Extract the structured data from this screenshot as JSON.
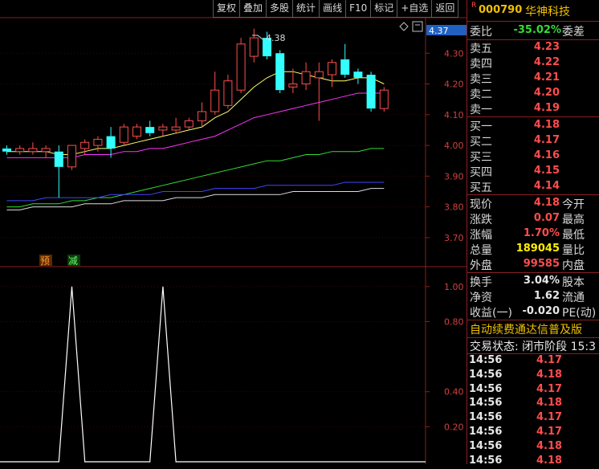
{
  "toolbar": [
    "复权",
    "叠加",
    "多股",
    "统计",
    "画线",
    "F10",
    "标记",
    "+自选",
    "返回"
  ],
  "chart": {
    "price_badge": "4.37",
    "high_label": "4.38",
    "price_axis": [
      "4.30",
      "4.20",
      "4.10",
      "4.00",
      "3.90",
      "3.80",
      "3.70"
    ],
    "markers": {
      "pre": "预",
      "reduce": "减"
    },
    "indicator_axis": [
      "1.00",
      "0.80",
      "0.40",
      "0.20"
    ],
    "collapse_icon": "diamond-icon"
  },
  "chart_data": {
    "type": "candlestick",
    "up_color": "#ff4d4d",
    "down_color": "#33ffff",
    "ylim": [
      3.65,
      4.4
    ],
    "candles": [
      {
        "o": 3.99,
        "h": 4.0,
        "l": 3.97,
        "c": 3.98
      },
      {
        "o": 3.98,
        "h": 4.0,
        "l": 3.97,
        "c": 3.99
      },
      {
        "o": 3.98,
        "h": 4.01,
        "l": 3.97,
        "c": 3.99
      },
      {
        "o": 3.98,
        "h": 4.0,
        "l": 3.96,
        "c": 3.99
      },
      {
        "o": 3.98,
        "h": 4.0,
        "l": 3.83,
        "c": 3.93
      },
      {
        "o": 3.93,
        "h": 4.0,
        "l": 3.92,
        "c": 4.0
      },
      {
        "o": 3.99,
        "h": 4.02,
        "l": 3.97,
        "c": 4.01
      },
      {
        "o": 4.0,
        "h": 4.03,
        "l": 3.98,
        "c": 4.02
      },
      {
        "o": 4.03,
        "h": 4.06,
        "l": 3.96,
        "c": 3.99
      },
      {
        "o": 4.01,
        "h": 4.07,
        "l": 4.0,
        "c": 4.06
      },
      {
        "o": 4.03,
        "h": 4.07,
        "l": 4.02,
        "c": 4.06
      },
      {
        "o": 4.06,
        "h": 4.08,
        "l": 4.03,
        "c": 4.04
      },
      {
        "o": 4.05,
        "h": 4.07,
        "l": 4.03,
        "c": 4.06
      },
      {
        "o": 4.05,
        "h": 4.09,
        "l": 4.04,
        "c": 4.06
      },
      {
        "o": 4.06,
        "h": 4.09,
        "l": 4.05,
        "c": 4.08
      },
      {
        "o": 4.08,
        "h": 4.14,
        "l": 4.06,
        "c": 4.11
      },
      {
        "o": 4.11,
        "h": 4.24,
        "l": 4.1,
        "c": 4.18
      },
      {
        "o": 4.13,
        "h": 4.23,
        "l": 4.12,
        "c": 4.21
      },
      {
        "o": 4.18,
        "h": 4.35,
        "l": 4.17,
        "c": 4.33
      },
      {
        "o": 4.29,
        "h": 4.38,
        "l": 4.27,
        "c": 4.35
      },
      {
        "o": 4.35,
        "h": 4.37,
        "l": 4.28,
        "c": 4.29
      },
      {
        "o": 4.3,
        "h": 4.31,
        "l": 4.17,
        "c": 4.18
      },
      {
        "o": 4.19,
        "h": 4.25,
        "l": 4.17,
        "c": 4.2
      },
      {
        "o": 4.2,
        "h": 4.27,
        "l": 4.18,
        "c": 4.24
      },
      {
        "o": 4.22,
        "h": 4.27,
        "l": 4.08,
        "c": 4.24
      },
      {
        "o": 4.23,
        "h": 4.28,
        "l": 4.19,
        "c": 4.27
      },
      {
        "o": 4.28,
        "h": 4.33,
        "l": 4.22,
        "c": 4.23
      },
      {
        "o": 4.24,
        "h": 4.25,
        "l": 4.2,
        "c": 4.22
      },
      {
        "o": 4.23,
        "h": 4.24,
        "l": 4.11,
        "c": 4.12
      },
      {
        "o": 4.12,
        "h": 4.19,
        "l": 4.11,
        "c": 4.18
      }
    ],
    "ma": [
      {
        "color": "#ffff66",
        "values": [
          3.98,
          3.98,
          3.98,
          3.98,
          3.97,
          3.97,
          3.98,
          3.99,
          3.99,
          4.0,
          4.01,
          4.02,
          4.03,
          4.04,
          4.05,
          4.06,
          4.09,
          4.11,
          4.15,
          4.19,
          4.22,
          4.24,
          4.24,
          4.23,
          4.22,
          4.21,
          4.21,
          4.22,
          4.22,
          4.2
        ]
      },
      {
        "color": "#ff33ff",
        "values": [
          3.96,
          3.96,
          3.96,
          3.96,
          3.96,
          3.96,
          3.97,
          3.97,
          3.97,
          3.98,
          3.98,
          3.99,
          3.99,
          4.0,
          4.01,
          4.02,
          4.03,
          4.05,
          4.07,
          4.09,
          4.1,
          4.11,
          4.12,
          4.13,
          4.14,
          4.15,
          4.16,
          4.17,
          4.17,
          4.17
        ]
      },
      {
        "color": "#33dd33",
        "values": [
          3.8,
          3.8,
          3.81,
          3.81,
          3.81,
          3.82,
          3.82,
          3.83,
          3.83,
          3.84,
          3.85,
          3.86,
          3.87,
          3.88,
          3.89,
          3.9,
          3.91,
          3.92,
          3.93,
          3.94,
          3.95,
          3.95,
          3.96,
          3.97,
          3.97,
          3.98,
          3.98,
          3.98,
          3.99,
          3.99
        ]
      },
      {
        "color": "#4444ff",
        "values": [
          3.82,
          3.82,
          3.82,
          3.83,
          3.83,
          3.83,
          3.83,
          3.83,
          3.84,
          3.84,
          3.84,
          3.84,
          3.85,
          3.85,
          3.85,
          3.85,
          3.86,
          3.86,
          3.86,
          3.86,
          3.87,
          3.87,
          3.87,
          3.87,
          3.87,
          3.87,
          3.88,
          3.88,
          3.88,
          3.88
        ]
      },
      {
        "color": "#dddddd",
        "values": [
          3.79,
          3.79,
          3.8,
          3.8,
          3.8,
          3.8,
          3.81,
          3.81,
          3.81,
          3.82,
          3.82,
          3.82,
          3.82,
          3.83,
          3.83,
          3.83,
          3.84,
          3.84,
          3.84,
          3.84,
          3.84,
          3.84,
          3.85,
          3.85,
          3.85,
          3.85,
          3.85,
          3.85,
          3.86,
          3.86
        ]
      }
    ],
    "indicator": {
      "ylim": [
        0,
        1.1
      ],
      "values": [
        0,
        0,
        0,
        0,
        0,
        1,
        0,
        0,
        0,
        0,
        0,
        0,
        1,
        0,
        0,
        0,
        0,
        0,
        0,
        0,
        0,
        0,
        0,
        0,
        0,
        0,
        0,
        0,
        0,
        0
      ]
    }
  },
  "quote": {
    "r_mark": "R",
    "code": "000790",
    "name": "华神科技",
    "weibi": {
      "label": "委比",
      "value": "-35.02%",
      "label2": "委差"
    },
    "asks": [
      {
        "label": "卖五",
        "price": "4.23"
      },
      {
        "label": "卖四",
        "price": "4.22"
      },
      {
        "label": "卖三",
        "price": "4.21"
      },
      {
        "label": "卖二",
        "price": "4.20"
      },
      {
        "label": "卖一",
        "price": "4.19"
      }
    ],
    "bids": [
      {
        "label": "买一",
        "price": "4.18"
      },
      {
        "label": "买二",
        "price": "4.17"
      },
      {
        "label": "买三",
        "price": "4.16"
      },
      {
        "label": "买四",
        "price": "4.15"
      },
      {
        "label": "买五",
        "price": "4.14"
      }
    ],
    "stats1": [
      {
        "label": "现价",
        "value": "4.18",
        "label2": "今开",
        "cls": "red"
      },
      {
        "label": "涨跌",
        "value": "0.07",
        "label2": "最高",
        "cls": "red"
      },
      {
        "label": "涨幅",
        "value": "1.70%",
        "label2": "最低",
        "cls": "red"
      },
      {
        "label": "总量",
        "value": "189045",
        "label2": "量比",
        "cls": "yellow"
      },
      {
        "label": "外盘",
        "value": "99585",
        "label2": "内盘",
        "cls": "red"
      }
    ],
    "stats2": [
      {
        "label": "换手",
        "value": "3.04%",
        "label2": "股本",
        "cls": "white"
      },
      {
        "label": "净资",
        "value": "1.62",
        "label2": "流通",
        "cls": "white"
      },
      {
        "label": "收益(一)",
        "value": "-0.020",
        "label2": "PE(动)",
        "cls": "white"
      }
    ],
    "ad": "自动续费通达信普及版",
    "state": "交易状态: 闭市阶段 15:3",
    "ticks": [
      {
        "time": "14:56",
        "price": "4.17"
      },
      {
        "time": "14:56",
        "price": "4.18"
      },
      {
        "time": "14:56",
        "price": "4.17"
      },
      {
        "time": "14:56",
        "price": "4.18"
      },
      {
        "time": "14:56",
        "price": "4.17"
      },
      {
        "time": "14:56",
        "price": "4.17"
      },
      {
        "time": "14:56",
        "price": "4.18"
      },
      {
        "time": "14:56",
        "price": "4.18"
      }
    ]
  }
}
